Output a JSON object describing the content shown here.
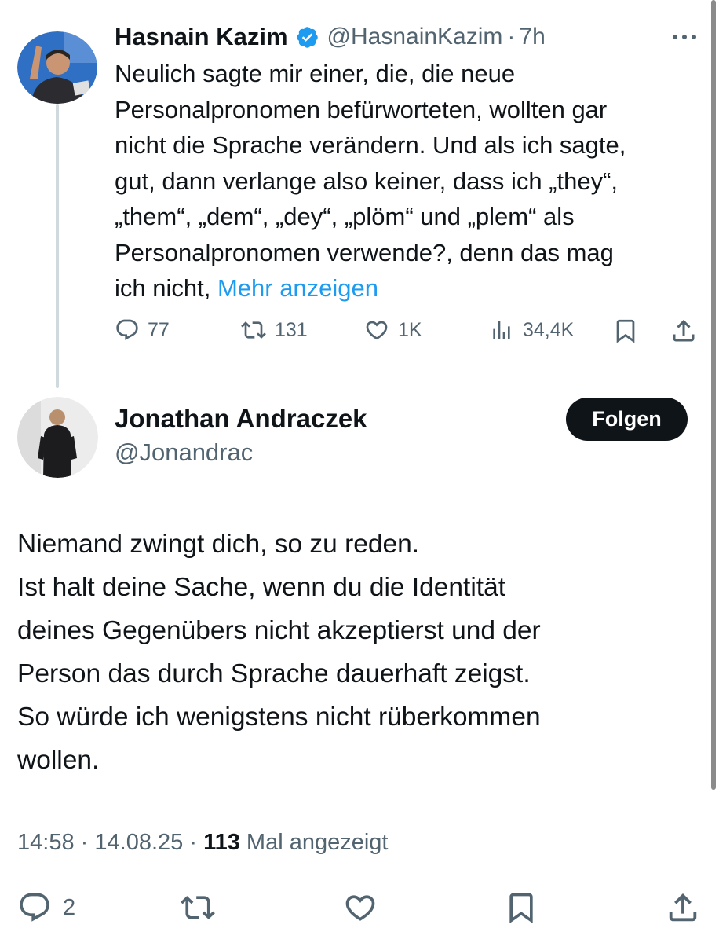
{
  "quoted": {
    "author_name": "Hasnain Kazim",
    "handle": "@HasnainKazim",
    "separator": "·",
    "time": "7h",
    "text": "Neulich sagte mir einer, die, die neue\nPersonalpronomen befürworteten, wollten gar\nnicht die Sprache verändern. Und als ich sagte,\ngut, dann verlange also keiner, dass ich „they“,\n„them“, „dem“, „dey“, „plöm“ und „plem“ als\nPersonalpronomen verwende?, denn das mag\nich nicht, ",
    "more_label": "Mehr anzeigen",
    "actions": {
      "replies": "77",
      "reposts": "131",
      "likes": "1K",
      "views": "34,4K"
    },
    "icons": [
      "verified-badge-icon",
      "more-options-icon",
      "reply-icon",
      "repost-icon",
      "like-icon",
      "views-icon",
      "bookmark-icon",
      "share-icon"
    ]
  },
  "main": {
    "author_name": "Jonathan Andraczek",
    "handle": "@Jonandrac",
    "follow_label": "Folgen",
    "text": "Niemand zwingt dich, so zu reden.\nIst halt deine Sache, wenn du die Identität\ndeines Gegenübers nicht akzeptierst und der\nPerson das durch Sprache dauerhaft zeigst.\nSo würde ich wenigstens nicht rüberkommen\nwollen.",
    "time": "14:58",
    "dot": "·",
    "date": "14.08.25",
    "views_count": "113",
    "views_label": "Mal angezeigt",
    "actions": {
      "replies": "2"
    }
  },
  "colors": {
    "text": "#0f1419",
    "secondary": "#536471",
    "link": "#1d9bf0",
    "verified": "#1d9bf0",
    "thread_line": "#cfd9de",
    "follow_bg": "#0f1419"
  }
}
